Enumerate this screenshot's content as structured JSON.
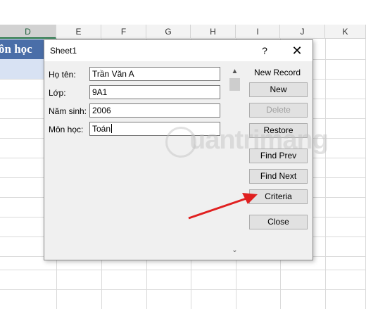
{
  "spreadsheet": {
    "columns": [
      "D",
      "E",
      "F",
      "G",
      "H",
      "I",
      "J",
      "K"
    ],
    "selected_column": "D",
    "cell_text": "ôn học"
  },
  "dialog": {
    "title": "Sheet1",
    "help_label": "?",
    "close_label": "✕",
    "fields": [
      {
        "label": "Họ tên:",
        "value": "Trần Văn A"
      },
      {
        "label": "Lớp:",
        "value": "9A1"
      },
      {
        "label": "Năm sinh:",
        "value": "2006"
      },
      {
        "label": "Môn học:",
        "value": "Toán"
      }
    ],
    "record_status": "New Record",
    "buttons": {
      "new": "New",
      "delete": "Delete",
      "restore": "Restore",
      "find_prev": "Find Prev",
      "find_next": "Find Next",
      "criteria": "Criteria",
      "close": "Close"
    },
    "scroll_up_glyph": "▲",
    "scroll_down_glyph": "⌄"
  },
  "watermark": "uantrimang",
  "colors": {
    "header_fill": "#4a6ea8",
    "selection_fill": "#d8e2f3",
    "arrow": "#e02020",
    "excel_green": "#217346"
  }
}
